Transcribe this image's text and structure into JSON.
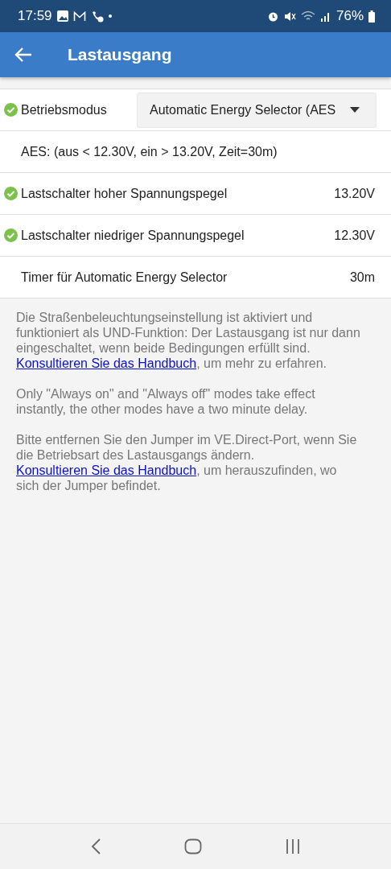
{
  "status_bar": {
    "time": "17:59",
    "battery": "76%"
  },
  "app_bar": {
    "title": "Lastausgang"
  },
  "settings": [
    {
      "kind": "dropdown",
      "label": "Betriebsmodus",
      "value": "Automatic Energy Selector (AES",
      "checked": true
    },
    {
      "kind": "info",
      "label": "AES: (aus < 12.30V, ein > 13.20V, Zeit=30m)",
      "checked": false
    },
    {
      "kind": "value",
      "label": "Lastschalter hoher Spannungspegel",
      "value": "13.20V",
      "checked": true
    },
    {
      "kind": "value",
      "label": "Lastschalter niedriger Spannungspegel",
      "value": "12.30V",
      "checked": true
    },
    {
      "kind": "value",
      "label": "Timer für Automatic Energy Selector",
      "value": "30m",
      "checked": false
    }
  ],
  "notes": [
    {
      "text": "Die Straßenbeleuchtungseinstellung ist aktiviert und funktioniert als UND-Funktion: Der Lastausgang ist nur dann eingeschaltet, wenn beide Bedingungen erfüllt sind.",
      "link": "Konsultieren Sie das Handbuch",
      "after": ", um mehr zu erfahren."
    },
    {
      "text": "Only \"Always on\" and \"Always off\" modes take effect instantly, the other modes have a two minute delay."
    },
    {
      "text": "Bitte entfernen Sie den Jumper im VE.Direct-Port, wenn Sie die Betriebsart des Lastausgangs ändern.",
      "link": "Konsultieren Sie das Handbuch",
      "after": ", um herauszufinden, wo sich der Jumper befindet."
    }
  ]
}
